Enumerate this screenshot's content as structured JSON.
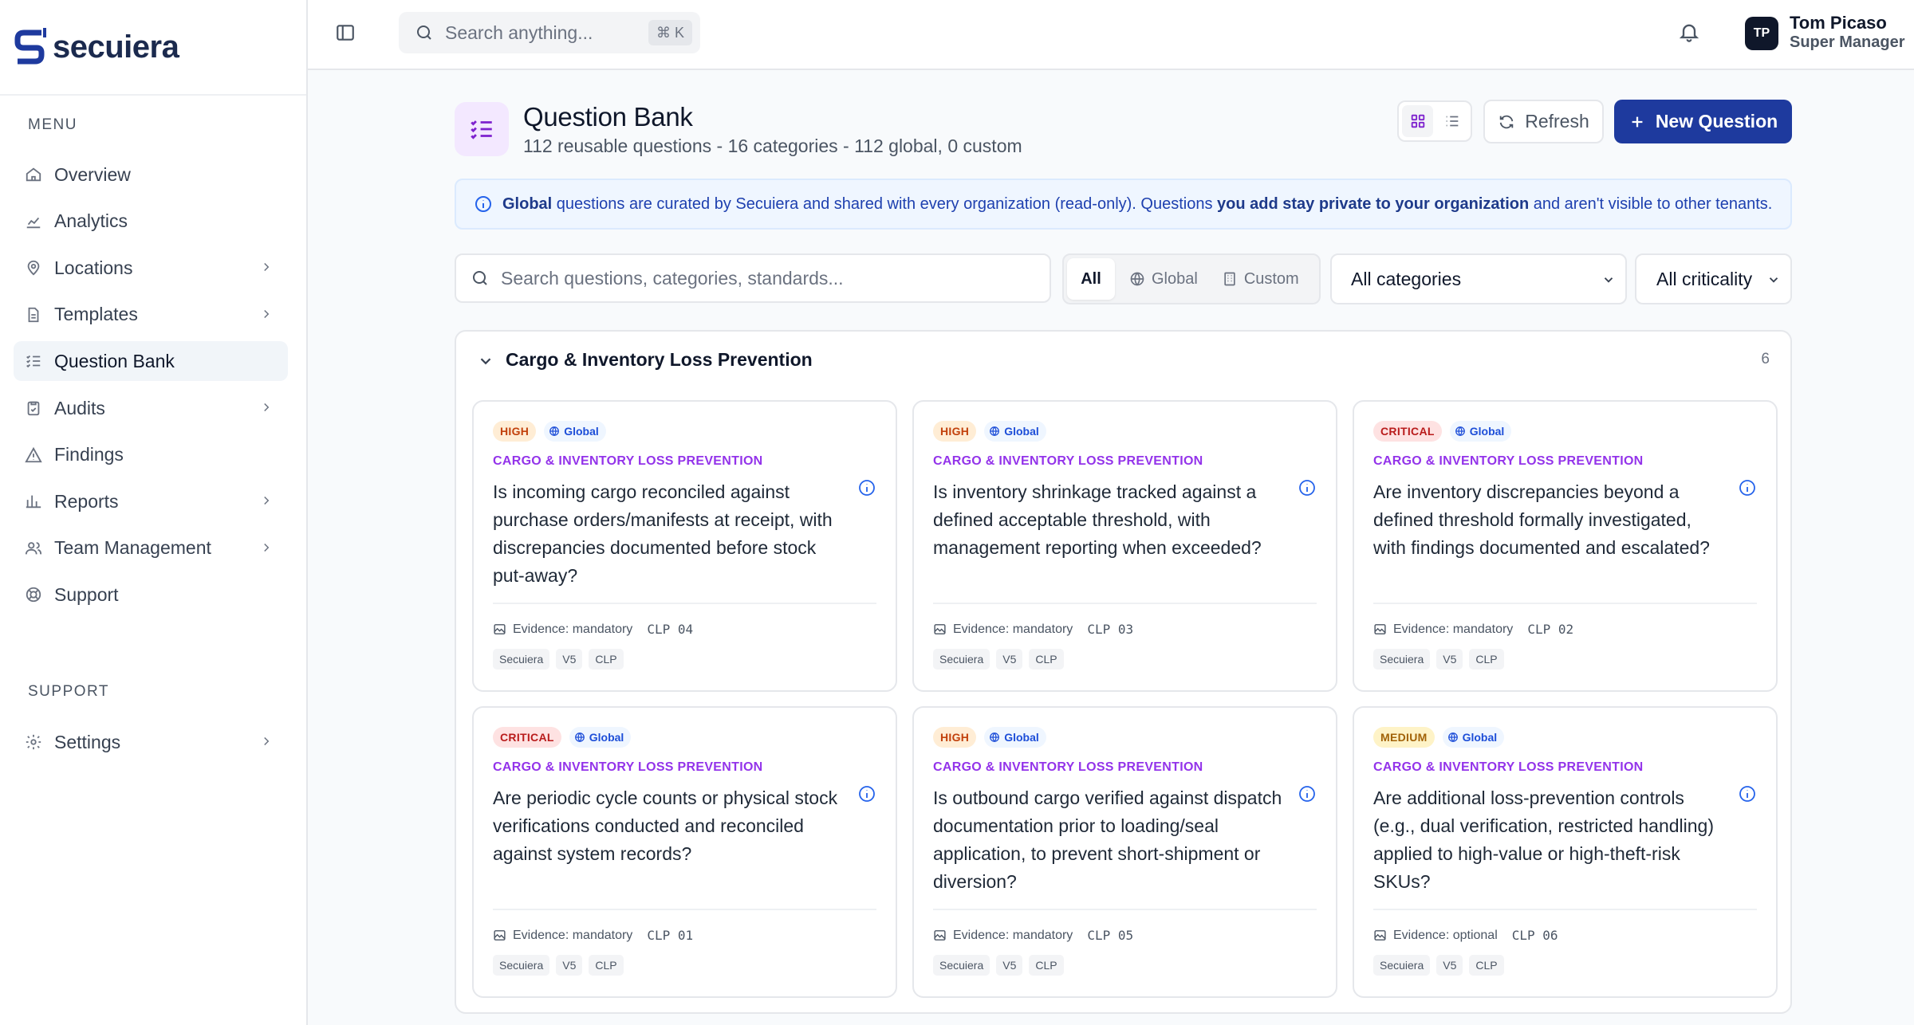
{
  "brand": {
    "name": "secuiera"
  },
  "sidebar": {
    "menu_label": "MENU",
    "support_label": "SUPPORT",
    "items": [
      {
        "label": "Overview",
        "icon": "home-icon",
        "chevron": false,
        "active": false
      },
      {
        "label": "Analytics",
        "icon": "chart-icon",
        "chevron": false,
        "active": false
      },
      {
        "label": "Locations",
        "icon": "map-pin-icon",
        "chevron": true,
        "active": false
      },
      {
        "label": "Templates",
        "icon": "file-icon",
        "chevron": true,
        "active": false
      },
      {
        "label": "Question Bank",
        "icon": "list-check-icon",
        "chevron": false,
        "active": true
      },
      {
        "label": "Audits",
        "icon": "clipboard-icon",
        "chevron": true,
        "active": false
      },
      {
        "label": "Findings",
        "icon": "warning-icon",
        "chevron": false,
        "active": false
      },
      {
        "label": "Reports",
        "icon": "bar-chart-icon",
        "chevron": true,
        "active": false
      },
      {
        "label": "Team Management",
        "icon": "users-icon",
        "chevron": true,
        "active": false
      },
      {
        "label": "Support",
        "icon": "lifebuoy-icon",
        "chevron": false,
        "active": false
      }
    ],
    "support_items": [
      {
        "label": "Settings",
        "icon": "gear-icon",
        "chevron": true
      }
    ]
  },
  "topbar": {
    "search_placeholder": "Search anything...",
    "shortcut": "⌘ K",
    "user": {
      "initials": "TP",
      "name": "Tom Picaso",
      "role": "Super Manager"
    }
  },
  "header": {
    "title": "Question Bank",
    "subtitle": "112 reusable questions - 16 categories - 112 global, 0 custom",
    "refresh_label": "Refresh",
    "new_label": "New Question"
  },
  "banner": {
    "part1_bold": "Global",
    "part2": " questions are curated by Secuiera and shared with every organization (read-only). Questions ",
    "part3_bold": "you add stay private to your organization",
    "part4": " and aren't visible to other tenants."
  },
  "filters": {
    "search_placeholder": "Search questions, categories, standards...",
    "segments": [
      "All",
      "Global",
      "Custom"
    ],
    "category_select": "All categories",
    "criticality_select": "All criticality"
  },
  "category": {
    "title": "Cargo & Inventory Loss Prevention",
    "count": "6",
    "cards": [
      {
        "criticality": "HIGH",
        "level": "high",
        "scope": "Global",
        "category": "CARGO & INVENTORY LOSS PREVENTION",
        "question": "Is incoming cargo reconciled against purchase orders/manifests at receipt, with discrepancies documented before stock put-away?",
        "evidence": "Evidence: mandatory",
        "code": "CLP 04",
        "tags": [
          "Secuiera",
          "V5",
          "CLP"
        ]
      },
      {
        "criticality": "HIGH",
        "level": "high",
        "scope": "Global",
        "category": "CARGO & INVENTORY LOSS PREVENTION",
        "question": "Is inventory shrinkage tracked against a defined acceptable threshold, with management reporting when exceeded?",
        "evidence": "Evidence: mandatory",
        "code": "CLP 03",
        "tags": [
          "Secuiera",
          "V5",
          "CLP"
        ]
      },
      {
        "criticality": "CRITICAL",
        "level": "critical",
        "scope": "Global",
        "category": "CARGO & INVENTORY LOSS PREVENTION",
        "question": "Are inventory discrepancies beyond a defined threshold formally investigated, with findings documented and escalated?",
        "evidence": "Evidence: mandatory",
        "code": "CLP 02",
        "tags": [
          "Secuiera",
          "V5",
          "CLP"
        ]
      },
      {
        "criticality": "CRITICAL",
        "level": "critical",
        "scope": "Global",
        "category": "CARGO & INVENTORY LOSS PREVENTION",
        "question": "Are periodic cycle counts or physical stock verifications conducted and reconciled against system records?",
        "evidence": "Evidence: mandatory",
        "code": "CLP 01",
        "tags": [
          "Secuiera",
          "V5",
          "CLP"
        ]
      },
      {
        "criticality": "HIGH",
        "level": "high",
        "scope": "Global",
        "category": "CARGO & INVENTORY LOSS PREVENTION",
        "question": "Is outbound cargo verified against dispatch documentation prior to loading/seal application, to prevent short-shipment or diversion?",
        "evidence": "Evidence: mandatory",
        "code": "CLP 05",
        "tags": [
          "Secuiera",
          "V5",
          "CLP"
        ]
      },
      {
        "criticality": "MEDIUM",
        "level": "medium",
        "scope": "Global",
        "category": "CARGO & INVENTORY LOSS PREVENTION",
        "question": "Are additional loss-prevention controls (e.g., dual verification, restricted handling) applied to high-value or high-theft-risk SKUs?",
        "evidence": "Evidence: optional",
        "code": "CLP 06",
        "tags": [
          "Secuiera",
          "V5",
          "CLP"
        ]
      }
    ]
  }
}
